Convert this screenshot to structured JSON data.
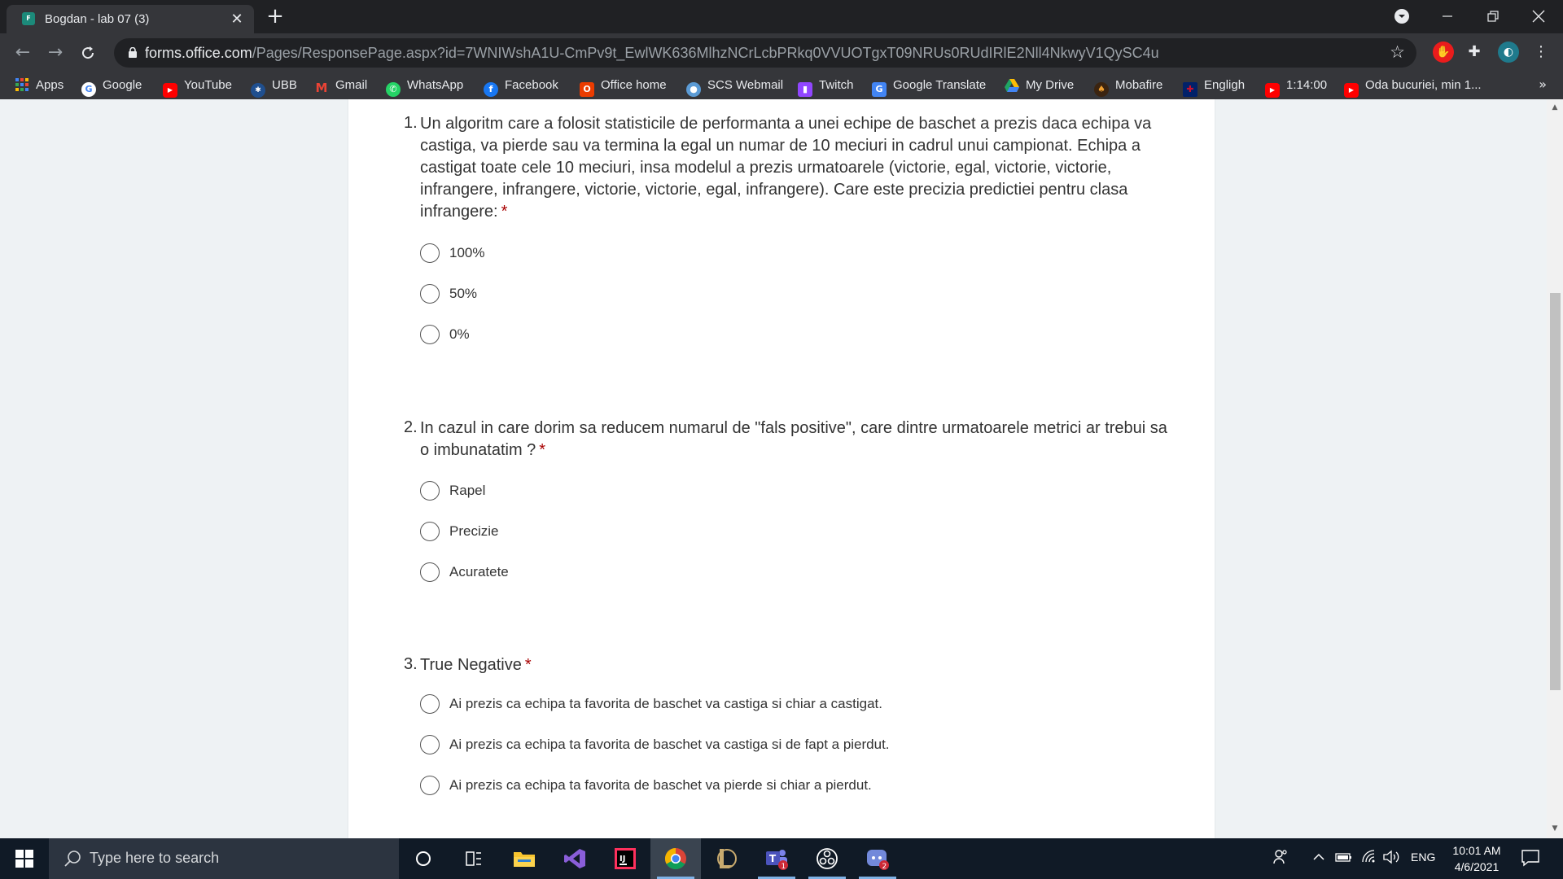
{
  "browser": {
    "tab_title": "Bogdan - lab 07 (3)",
    "tab_favicon_text": "F",
    "url_host": "forms.office.com",
    "url_path": "/Pages/ResponsePage.aspx?id=7WNIWshA1U-CmPv9t_EwlWK636MlhzNCrLcbPRkq0VVUOTgxT09NRUs0RUdIRlE2Nll4NkwyV1QySC4u",
    "bookmarks": [
      {
        "label": "Apps",
        "icon": "apps-grid-icon",
        "color": "#4285f4"
      },
      {
        "label": "Google",
        "icon": "google-icon",
        "color": "#ffffff"
      },
      {
        "label": "YouTube",
        "icon": "youtube-icon",
        "color": "#ff0000"
      },
      {
        "label": "UBB",
        "icon": "ubb-icon",
        "color": "#1f4f8f"
      },
      {
        "label": "Gmail",
        "icon": "gmail-icon",
        "color": "#ea4335"
      },
      {
        "label": "WhatsApp",
        "icon": "whatsapp-icon",
        "color": "#25d366"
      },
      {
        "label": "Facebook",
        "icon": "facebook-icon",
        "color": "#1877f2"
      },
      {
        "label": "Office home",
        "icon": "office-icon",
        "color": "#eb3c00"
      },
      {
        "label": "SCS Webmail",
        "icon": "webmail-icon",
        "color": "#5b9bd5"
      },
      {
        "label": "Twitch",
        "icon": "twitch-icon",
        "color": "#9146ff"
      },
      {
        "label": "Google Translate",
        "icon": "translate-icon",
        "color": "#4285f4"
      },
      {
        "label": "My Drive",
        "icon": "drive-icon",
        "color": "#1fa463"
      },
      {
        "label": "Mobafire",
        "icon": "mobafire-icon",
        "color": "#c8641e"
      },
      {
        "label": "Engligh",
        "icon": "uk-flag-icon",
        "color": "#012169"
      },
      {
        "label": "1:14:00",
        "icon": "youtube-icon",
        "color": "#ff0000"
      },
      {
        "label": "Oda bucuriei, min 1...",
        "icon": "youtube-icon",
        "color": "#ff0000"
      }
    ],
    "bookmarks_more": "»"
  },
  "form": {
    "questions": [
      {
        "number": "1.",
        "text": "Un algoritm care a folosit statisticile de performanta a unei echipe de baschet a prezis daca echipa va castiga, va pierde sau va termina la egal un numar de 10 meciuri in cadrul unui campionat. Echipa a castigat toate cele 10 meciuri, insa modelul a prezis urmatoarele (victorie, egal, victorie, victorie, infrangere, infrangere, victorie, victorie, egal, infrangere). Care este precizia predictiei pentru clasa infrangere:",
        "required_mark": "*",
        "options": [
          "100%",
          "50%",
          "0%"
        ]
      },
      {
        "number": "2.",
        "text": "In cazul in care dorim sa reducem numarul de \"fals positive\", care dintre urmatoarele metrici ar trebui sa o imbunatatim ?",
        "required_mark": "*",
        "options": [
          "Rapel",
          "Precizie",
          "Acuratete"
        ]
      },
      {
        "number": "3.",
        "text": "True Negative",
        "required_mark": "*",
        "options": [
          "Ai prezis ca echipa ta favorita de baschet va castiga si chiar a castigat.",
          "Ai prezis ca echipa ta favorita de baschet va castiga si de fapt a pierdut.",
          "Ai prezis ca echipa ta favorita de baschet va pierde si chiar a pierdut."
        ]
      }
    ]
  },
  "taskbar": {
    "search_placeholder": "Type here to search",
    "language": "ENG",
    "time": "10:01 AM",
    "date": "4/6/2021",
    "teams_badge": "1",
    "discord_badge": "2"
  },
  "colors": {
    "required": "#a80000",
    "chrome_dark": "#202124",
    "taskbar": "#101a26"
  }
}
